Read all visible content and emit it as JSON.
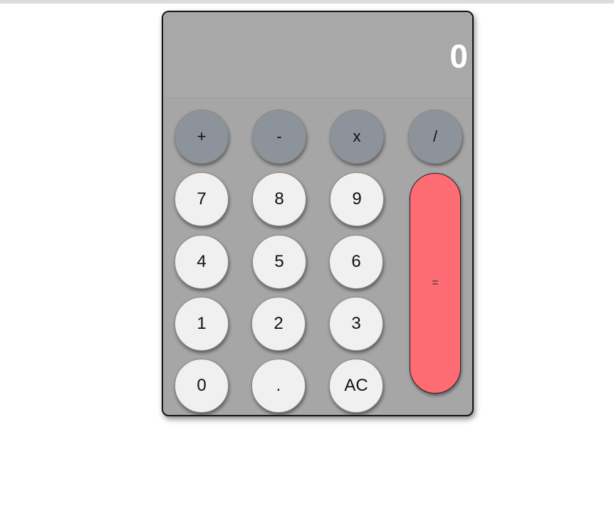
{
  "calculator": {
    "display": "0",
    "keys": {
      "add": "+",
      "subtract": "-",
      "multiply": "x",
      "divide": "/",
      "seven": "7",
      "eight": "8",
      "nine": "9",
      "four": "4",
      "five": "5",
      "six": "6",
      "one": "1",
      "two": "2",
      "three": "3",
      "zero": "0",
      "decimal": ".",
      "clear": "AC",
      "equals": "="
    },
    "colors": {
      "body": "#a6a6a6",
      "operator_key": "#8d939a",
      "number_key": "#f0f0f0",
      "equals_key": "#fd6b73",
      "display_text": "#ffffff"
    }
  }
}
